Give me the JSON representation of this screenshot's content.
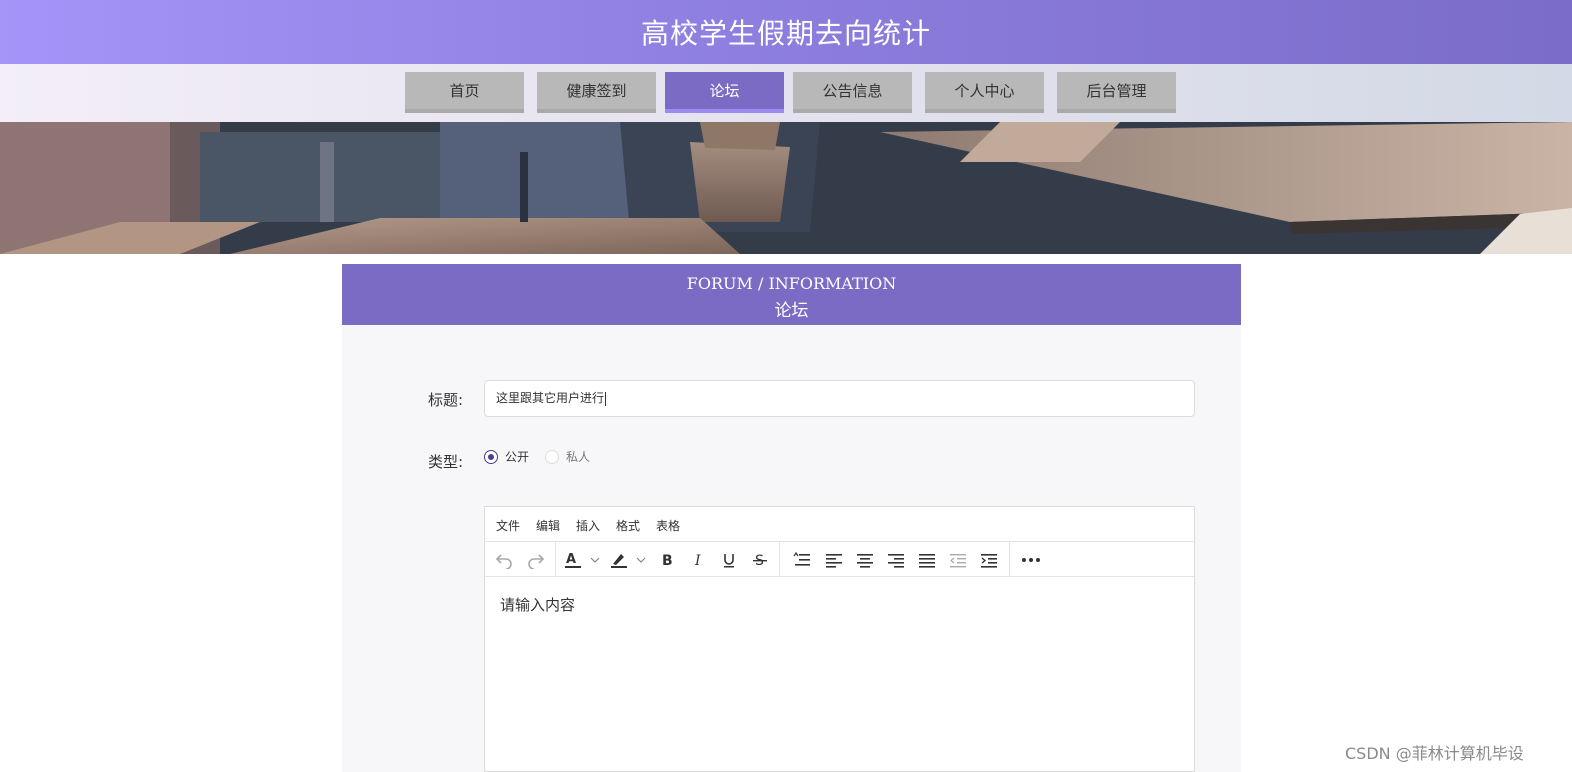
{
  "header": {
    "title": "高校学生假期去向统计"
  },
  "nav": {
    "items": [
      {
        "label": "首页"
      },
      {
        "label": "健康签到"
      },
      {
        "label": "论坛"
      },
      {
        "label": "公告信息"
      },
      {
        "label": "个人中心"
      },
      {
        "label": "后台管理"
      }
    ],
    "active_index": 2
  },
  "section": {
    "title_en": "FORUM / INFORMATION",
    "title_zh": "论坛"
  },
  "form": {
    "title_label": "标题:",
    "title_value": "这里跟其它用户进行",
    "type_label": "类型:",
    "type_options": [
      {
        "label": "公开",
        "checked": true
      },
      {
        "label": "私人",
        "checked": false
      }
    ]
  },
  "editor": {
    "menus": [
      {
        "label": "文件"
      },
      {
        "label": "编辑"
      },
      {
        "label": "插入"
      },
      {
        "label": "格式"
      },
      {
        "label": "表格"
      }
    ],
    "toolbar_icons": [
      "undo-icon",
      "redo-icon",
      "font-color-icon",
      "highlight-icon",
      "bold-icon",
      "italic-icon",
      "underline-icon",
      "strikethrough-icon",
      "line-height-icon",
      "align-left-icon",
      "align-center-icon",
      "align-right-icon",
      "align-justify-icon",
      "outdent-icon",
      "indent-icon",
      "more-icon"
    ],
    "placeholder": "请输入内容"
  },
  "watermark": "CSDN @菲林计算机毕设",
  "colors": {
    "accent": "#7b6bc5",
    "header_start": "#a594f9",
    "header_end": "#7b6cc9"
  }
}
